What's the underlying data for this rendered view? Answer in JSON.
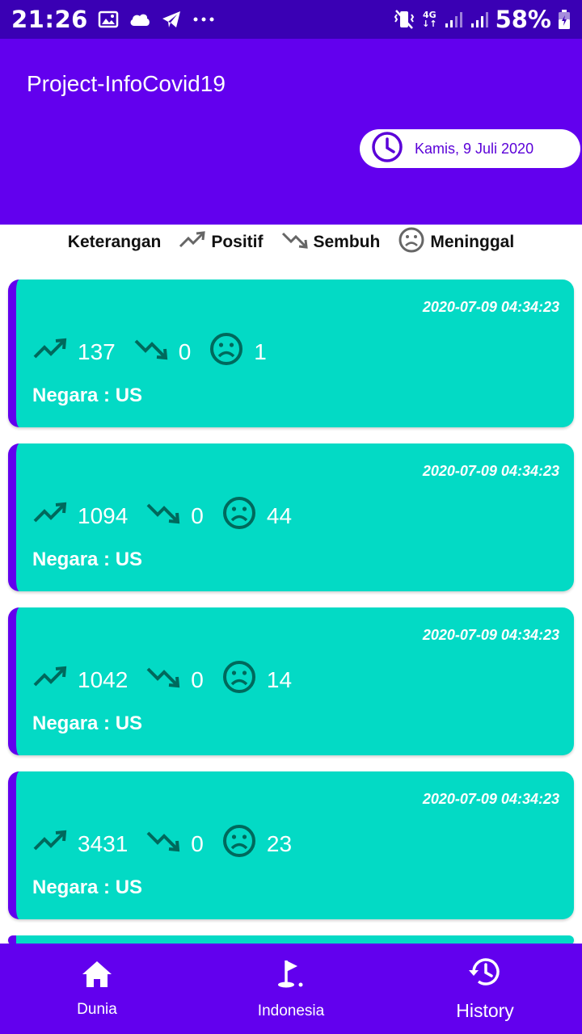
{
  "status_bar": {
    "time": "21:26",
    "network": "4G",
    "battery": "58%"
  },
  "header": {
    "title": "Project-InfoCovid19",
    "date": "Kamis, 9 Juli 2020"
  },
  "legend": {
    "title": "Keterangan",
    "positive": "Positif",
    "recovered": "Sembuh",
    "death": "Meninggal"
  },
  "cards": [
    {
      "timestamp": "2020-07-09 04:34:23",
      "positive": "137",
      "recovered": "0",
      "deaths": "1",
      "country": "Negara : US"
    },
    {
      "timestamp": "2020-07-09 04:34:23",
      "positive": "1094",
      "recovered": "0",
      "deaths": "44",
      "country": "Negara : US"
    },
    {
      "timestamp": "2020-07-09 04:34:23",
      "positive": "1042",
      "recovered": "0",
      "deaths": "14",
      "country": "Negara : US"
    },
    {
      "timestamp": "2020-07-09 04:34:23",
      "positive": "3431",
      "recovered": "0",
      "deaths": "23",
      "country": "Negara : US"
    }
  ],
  "bottom_nav": {
    "items": [
      {
        "label": "Dunia",
        "icon": "home-icon"
      },
      {
        "label": "Indonesia",
        "icon": "golf-flag-icon"
      },
      {
        "label": "History",
        "icon": "history-icon"
      }
    ],
    "active": "History"
  },
  "colors": {
    "primary": "#6200ee",
    "status_bar": "#3a00b4",
    "card": "#03dac5",
    "icon_dark": "#00695c"
  }
}
